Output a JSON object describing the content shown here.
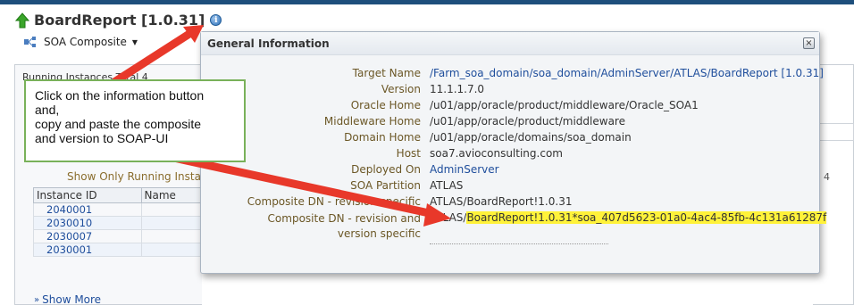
{
  "header": {
    "title": "BoardReport [1.0.31]",
    "composite_menu_label": "SOA Composite",
    "info_icon_glyph": "i"
  },
  "background": {
    "tabs_text": "Running Instances    Total 4",
    "show_running_label": "Show Only Running Instances",
    "count_label": "4",
    "table": {
      "headers": [
        "Instance ID",
        "Name"
      ],
      "rows": [
        [
          "2040001",
          ""
        ],
        [
          "2030010",
          ""
        ],
        [
          "2030007",
          ""
        ],
        [
          "2030001",
          ""
        ]
      ]
    },
    "show_more_label": "Show More"
  },
  "popup": {
    "title": "General Information",
    "close_glyph": "×",
    "fields": {
      "target_name": {
        "label": "Target Name",
        "value": "/Farm_soa_domain/soa_domain/AdminServer/ATLAS/BoardReport [1.0.31]"
      },
      "version": {
        "label": "Version",
        "value": "11.1.1.7.0"
      },
      "oracle_home": {
        "label": "Oracle Home",
        "value": "/u01/app/oracle/product/middleware/Oracle_SOA1"
      },
      "middleware_home": {
        "label": "Middleware Home",
        "value": "/u01/app/oracle/product/middleware"
      },
      "domain_home": {
        "label": "Domain Home",
        "value": "/u01/app/oracle/domains/soa_domain"
      },
      "host": {
        "label": "Host",
        "value": "soa7.avioconsulting.com"
      },
      "deployed_on": {
        "label": "Deployed On",
        "value": "AdminServer"
      },
      "soa_partition": {
        "label": "SOA Partition",
        "value": "ATLAS"
      },
      "composite_dn_revision_specific": {
        "label": "Composite DN - revision specific",
        "value": "ATLAS/BoardReport!1.0.31"
      },
      "composite_dn_revision_version_specific": {
        "label": "Composite DN - revision and version specific",
        "value_prefix": "ATLAS/",
        "value_highlight": "BoardReport!1.0.31*soa_407d5623-01a0-4ac4-85fb-4c131a61287f"
      }
    }
  },
  "callout": {
    "line1": "Click on the information button",
    "line2": "and,",
    "line3": "copy and paste the composite",
    "line4": "and version to SOAP-UI"
  },
  "colors": {
    "arrow": "#e8382a",
    "highlight": "#fff23a",
    "callout_border": "#79b15a",
    "link": "#1f4e9c",
    "label": "#6b5726"
  }
}
